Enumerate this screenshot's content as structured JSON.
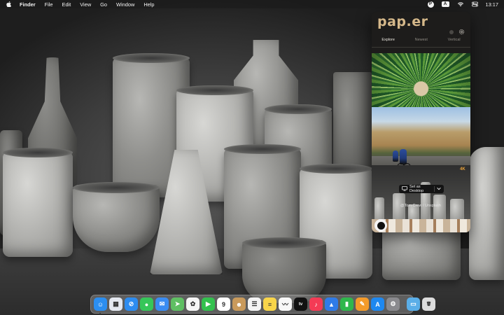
{
  "menubar": {
    "apple_icon": "apple-logo-icon",
    "app_name": "Finder",
    "menus": [
      "File",
      "Edit",
      "View",
      "Go",
      "Window",
      "Help"
    ],
    "status_icons": [
      "paper-app-icon",
      "keyboard-input-icon",
      "wifi-icon",
      "control-center-icon"
    ],
    "input_label": "A",
    "paper_label": "P",
    "time": "13:17"
  },
  "popover": {
    "logo": "pap.er",
    "icons": [
      "dot-icon",
      "gear-icon"
    ],
    "tabs": [
      {
        "label": "Explore",
        "active": true
      },
      {
        "label": "Newest",
        "active": false
      },
      {
        "label": "Vertical",
        "active": false
      }
    ],
    "badge": "4K",
    "action_button": {
      "label": "Set as Desktop",
      "icon": "display-icon",
      "menu_icon": "chevron-down-icon"
    },
    "credit": "@Tom Crew / Unsplash",
    "accent": "#d5b88a",
    "badge_color": "#e8a23a"
  },
  "dock": {
    "apps": [
      {
        "name": "Finder",
        "icon": "finder-icon",
        "glyph": "☺",
        "color": "#2b8ef0"
      },
      {
        "name": "Launchpad",
        "icon": "launchpad-icon",
        "glyph": "▦",
        "color": "#e4e8f0"
      },
      {
        "name": "Safari",
        "icon": "safari-icon",
        "glyph": "⊘",
        "color": "#2d8cf0"
      },
      {
        "name": "Messages",
        "icon": "messages-icon",
        "glyph": "●",
        "color": "#36c659"
      },
      {
        "name": "Mail",
        "icon": "mail-icon",
        "glyph": "✉",
        "color": "#3a8cf2"
      },
      {
        "name": "Maps",
        "icon": "maps-icon",
        "glyph": "➤",
        "color": "#5fbf63"
      },
      {
        "name": "Photos",
        "icon": "photos-icon",
        "glyph": "✿",
        "color": "#f6f6f6"
      },
      {
        "name": "FaceTime",
        "icon": "facetime-icon",
        "glyph": "▶",
        "color": "#33c14e"
      },
      {
        "name": "Calendar",
        "icon": "calendar-icon",
        "glyph": "9",
        "color": "#ffffff"
      },
      {
        "name": "Contacts",
        "icon": "contacts-icon",
        "glyph": "☻",
        "color": "#c99a5b"
      },
      {
        "name": "Reminders",
        "icon": "reminders-icon",
        "glyph": "☰",
        "color": "#f4f4f4"
      },
      {
        "name": "Notes",
        "icon": "notes-icon",
        "glyph": "≡",
        "color": "#f8d54a"
      },
      {
        "name": "Freeform",
        "icon": "freeform-icon",
        "glyph": "〰",
        "color": "#f7f7f7"
      },
      {
        "name": "TV",
        "icon": "apple-tv-icon",
        "glyph": "tv",
        "color": "#111111"
      },
      {
        "name": "Music",
        "icon": "music-icon",
        "glyph": "♪",
        "color": "#f43b55"
      },
      {
        "name": "Keynote",
        "icon": "keynote-icon",
        "glyph": "▲",
        "color": "#2f7be8"
      },
      {
        "name": "Numbers",
        "icon": "numbers-icon",
        "glyph": "▮",
        "color": "#2fb74c"
      },
      {
        "name": "Pages",
        "icon": "pages-icon",
        "glyph": "✎",
        "color": "#f49b2a"
      },
      {
        "name": "App Store",
        "icon": "app-store-icon",
        "glyph": "A",
        "color": "#1e88f0"
      },
      {
        "name": "System Settings",
        "icon": "system-settings-icon",
        "glyph": "⚙",
        "color": "#8a8a8e"
      }
    ],
    "stack_apps": [
      {
        "name": "Downloads",
        "icon": "downloads-folder-icon",
        "glyph": "▭",
        "color": "#5aaee8"
      },
      {
        "name": "Trash",
        "icon": "trash-icon",
        "glyph": "🗑",
        "color": "#dcdcdc"
      }
    ]
  }
}
